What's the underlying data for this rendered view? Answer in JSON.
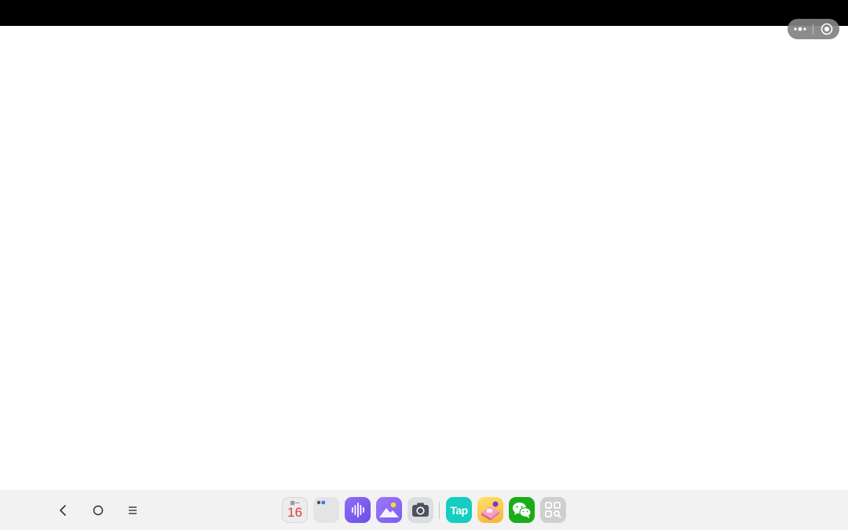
{
  "status_bar": {
    "color": "#000000"
  },
  "capsule": {
    "more_icon": "more-dots-icon",
    "close_icon": "record-circle-icon"
  },
  "navigation": {
    "back_icon": "back-chevron-icon",
    "home_icon": "home-circle-icon",
    "recents_icon": "menu-lines-icon"
  },
  "dock": {
    "apps": [
      {
        "id": "calendar",
        "icon": "calendar-icon",
        "weekday": "周一",
        "day": "16"
      },
      {
        "id": "folder",
        "icon": "folder-icon"
      },
      {
        "id": "recorder",
        "icon": "sound-wave-icon",
        "color": "#7b5cf0"
      },
      {
        "id": "gallery",
        "icon": "gallery-icon",
        "color": "#8f6af5"
      },
      {
        "id": "camera",
        "icon": "camera-icon",
        "color": "#5c6370"
      },
      {
        "id": "taptap",
        "icon": "taptap-icon",
        "label": "Tap",
        "color": "#19d3c5"
      },
      {
        "id": "game",
        "icon": "game-icon",
        "color": "#f5c842"
      },
      {
        "id": "wechat",
        "icon": "wechat-icon",
        "color": "#1aad19"
      },
      {
        "id": "app-search",
        "icon": "app-search-icon",
        "color": "#c9c9c9"
      }
    ]
  }
}
